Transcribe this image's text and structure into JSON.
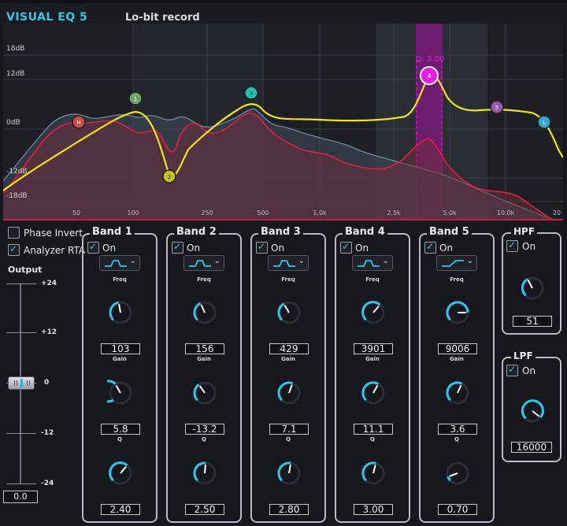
{
  "app": {
    "title": "VISUAL EQ 5",
    "preset": "Lo-bit record"
  },
  "graph": {
    "db_labels": [
      "18dB",
      "12dB",
      "0dB",
      "-12dB",
      "-18dB"
    ],
    "freq_labels": [
      "50",
      "100",
      "250",
      "500",
      "1.0k",
      "2.5k",
      "5.0k",
      "10.0k",
      "20"
    ],
    "q_readout": "Q: 3.00",
    "nodes": [
      "H",
      "1",
      "2",
      "3",
      "4",
      "5",
      "L"
    ],
    "colors": {
      "curve": "#f2e21b",
      "analyzer": "#e8203e",
      "selected": "#e21ee0",
      "accent": "#36c6ea"
    }
  },
  "options": {
    "phase_invert": {
      "label": "Phase Invert",
      "checked": false
    },
    "analyzer_rta": {
      "label": "Analyzer RTA",
      "checked": true
    }
  },
  "output": {
    "label": "Output",
    "scale": [
      "+24",
      "+12",
      "0",
      "-12",
      "-24"
    ],
    "value": "0.0"
  },
  "bands": [
    {
      "name": "Band 1",
      "on_label": "On",
      "freq_label": "Freq",
      "freq": "103",
      "gain_label": "Gain",
      "gain": "5.8",
      "q_label": "Q",
      "q": "2.40",
      "shape": "bell"
    },
    {
      "name": "Band 2",
      "on_label": "On",
      "freq_label": "Freq",
      "freq": "156",
      "gain_label": "Gain",
      "gain": "-13.2",
      "q_label": "Q",
      "q": "2.50",
      "shape": "bell"
    },
    {
      "name": "Band 3",
      "on_label": "On",
      "freq_label": "Freq",
      "freq": "429",
      "gain_label": "Gain",
      "gain": "7.1",
      "q_label": "Q",
      "q": "2.80",
      "shape": "bell"
    },
    {
      "name": "Band 4",
      "on_label": "On",
      "freq_label": "Freq",
      "freq": "3901",
      "gain_label": "Gain",
      "gain": "11.1",
      "q_label": "Q",
      "q": "3.00",
      "shape": "bell"
    },
    {
      "name": "Band 5",
      "on_label": "On",
      "freq_label": "Freq",
      "freq": "9006",
      "gain_label": "Gain",
      "gain": "3.6",
      "q_label": "Q",
      "q": "0.70",
      "shape": "high-shelf"
    }
  ],
  "hpf": {
    "name": "HPF",
    "on_label": "On",
    "value": "51"
  },
  "lpf": {
    "name": "LPF",
    "on_label": "On",
    "value": "16000"
  }
}
